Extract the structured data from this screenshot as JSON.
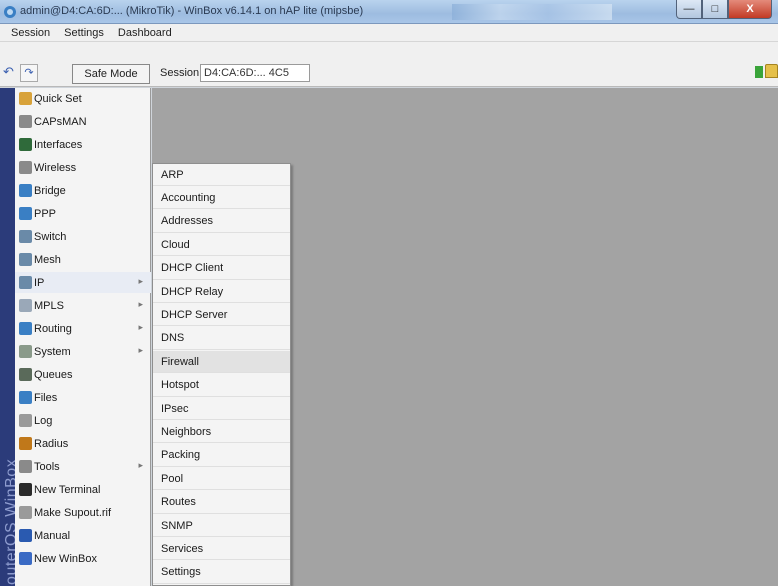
{
  "window": {
    "title": "admin@D4:CA:6D:... (MikroTik) - WinBox v6.14.1 on hAP lite (mipsbe)",
    "min_icon": "minimize-icon",
    "max_icon": "maximize-icon",
    "close_label": "X"
  },
  "menubar": {
    "items": [
      "Session",
      "Settings",
      "Dashboard"
    ]
  },
  "toolbar": {
    "undo_icon": "undo-icon",
    "redo_icon": "redo-icon",
    "safe_mode_label": "Safe Mode",
    "session_label": "Session:",
    "session_value": "D4:CA:6D:... 4C5"
  },
  "brand": "RouterOS WinBox",
  "left_menu": [
    {
      "label": "Quick Set",
      "icon": "quickset-icon",
      "color": "#d8a23a"
    },
    {
      "label": "CAPsMAN",
      "icon": "capsman-icon",
      "color": "#8a8a8a"
    },
    {
      "label": "Interfaces",
      "icon": "interfaces-icon",
      "color": "#2f6a3a"
    },
    {
      "label": "Wireless",
      "icon": "wireless-icon",
      "color": "#8a8a8a"
    },
    {
      "label": "Bridge",
      "icon": "bridge-icon",
      "color": "#3a7fc4"
    },
    {
      "label": "PPP",
      "icon": "ppp-icon",
      "color": "#3a7fc4"
    },
    {
      "label": "Switch",
      "icon": "switch-icon",
      "color": "#6a8aa8"
    },
    {
      "label": "Mesh",
      "icon": "mesh-icon",
      "color": "#6a8aa8"
    },
    {
      "label": "IP",
      "icon": "ip-icon",
      "color": "#6a8aa8",
      "arrow": true
    },
    {
      "label": "MPLS",
      "icon": "mpls-icon",
      "color": "#9aa8b8",
      "arrow": true
    },
    {
      "label": "Routing",
      "icon": "routing-icon",
      "color": "#3a7fc4",
      "arrow": true
    },
    {
      "label": "System",
      "icon": "system-icon",
      "color": "#8a9a8a",
      "arrow": true
    },
    {
      "label": "Queues",
      "icon": "queues-icon",
      "color": "#5a6a5a"
    },
    {
      "label": "Files",
      "icon": "files-icon",
      "color": "#3a7fc4"
    },
    {
      "label": "Log",
      "icon": "log-icon",
      "color": "#9a9a9a"
    },
    {
      "label": "Radius",
      "icon": "radius-icon",
      "color": "#c0781a"
    },
    {
      "label": "Tools",
      "icon": "tools-icon",
      "color": "#8a8a8a",
      "arrow": true
    },
    {
      "label": "New Terminal",
      "icon": "terminal-icon",
      "color": "#2a2a2a"
    },
    {
      "label": "Make Supout.rif",
      "icon": "supout-icon",
      "color": "#9a9a9a"
    },
    {
      "label": "Manual",
      "icon": "manual-icon",
      "color": "#2a5ab0"
    },
    {
      "label": "New WinBox",
      "icon": "winbox-icon",
      "color": "#3a6ac4"
    }
  ],
  "submenu": [
    "ARP",
    "Accounting",
    "Addresses",
    "Cloud",
    "DHCP Client",
    "DHCP Relay",
    "DHCP Server",
    "DNS",
    "Firewall",
    "Hotspot",
    "IPsec",
    "Neighbors",
    "Packing",
    "Pool",
    "Routes",
    "SNMP",
    "Services",
    "Settings"
  ]
}
